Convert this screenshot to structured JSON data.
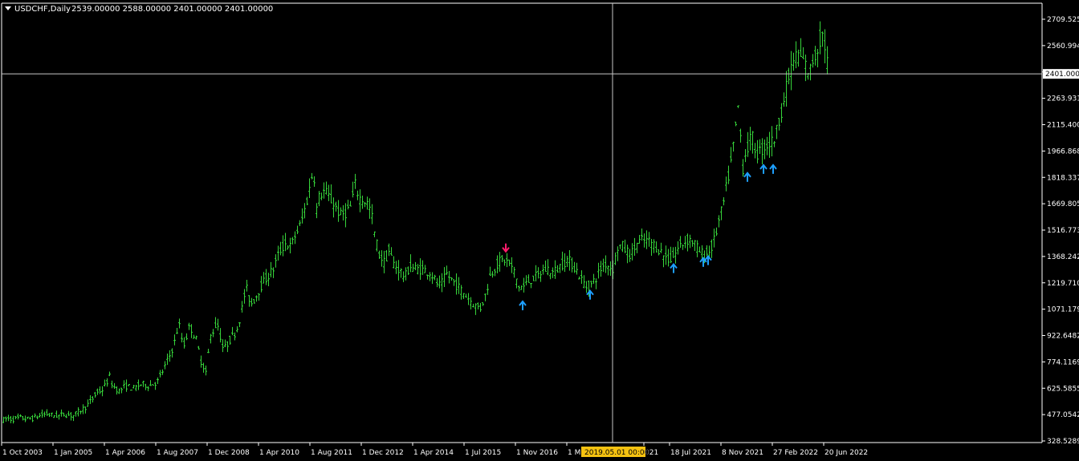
{
  "header": {
    "symbol": "USDCHF,Daily",
    "ohlc": "2539.00000 2588.00000 2401.00000 2401.00000"
  },
  "colors": {
    "background": "#000000",
    "bars": "#36d43a",
    "axis": "#ffffff",
    "crosshair": "#c8c8c8",
    "arrow_up": "#1e9fff",
    "arrow_down": "#ff1b6b",
    "cursor_label_bg": "#f5c211",
    "price_label_bg": "#ffffff"
  },
  "crosshair": {
    "price_label": "2401.00000",
    "time_label": "2019.05.01 00:00",
    "price": 2401.0
  },
  "chart_data": {
    "type": "ohlc",
    "ylim": [
      328.52894,
      2790
    ],
    "y_ticks": [
      "2709.52549",
      "2560.99409",
      "2401.00000",
      "2263.93125",
      "2115.40000",
      "1966.86875",
      "1818.33750",
      "1669.80550",
      "1516.77340",
      "1368.24225",
      "1219.71000",
      "1071.17900",
      "922.64825",
      "774.11690",
      "625.58555",
      "477.05420",
      "328.52894"
    ],
    "x_labels": [
      "1 Oct 2003",
      "1 Jan 2005",
      "1 Apr 2006",
      "1 Aug 2007",
      "1 Dec 2008",
      "1 Apr 2010",
      "1 Aug 2011",
      "1 Dec 2012",
      "1 Apr 2014",
      "1 Jul 2015",
      "1 Nov 2016",
      "1 M",
      "021",
      "18 Jul 2021",
      "8 Nov 2021",
      "27 Feb 2022",
      "20 Jun 2022"
    ],
    "path": [
      [
        0,
        440
      ],
      [
        8,
        455
      ],
      [
        16,
        450
      ],
      [
        24,
        460
      ],
      [
        32,
        452
      ],
      [
        40,
        455
      ],
      [
        48,
        470
      ],
      [
        56,
        480
      ],
      [
        64,
        475
      ],
      [
        72,
        470
      ],
      [
        80,
        480
      ],
      [
        90,
        470
      ],
      [
        98,
        495
      ],
      [
        106,
        520
      ],
      [
        114,
        560
      ],
      [
        120,
        600
      ],
      [
        128,
        620
      ],
      [
        136,
        690
      ],
      [
        140,
        640
      ],
      [
        148,
        610
      ],
      [
        156,
        640
      ],
      [
        166,
        625
      ],
      [
        176,
        650
      ],
      [
        186,
        640
      ],
      [
        196,
        665
      ],
      [
        204,
        740
      ],
      [
        212,
        820
      ],
      [
        218,
        900
      ],
      [
        222,
        1000
      ],
      [
        228,
        860
      ],
      [
        236,
        980
      ],
      [
        244,
        900
      ],
      [
        250,
        780
      ],
      [
        256,
        720
      ],
      [
        262,
        920
      ],
      [
        270,
        1000
      ],
      [
        278,
        840
      ],
      [
        286,
        900
      ],
      [
        294,
        950
      ],
      [
        300,
        1050
      ],
      [
        306,
        1200
      ],
      [
        312,
        1100
      ],
      [
        318,
        1140
      ],
      [
        324,
        1200
      ],
      [
        332,
        1250
      ],
      [
        340,
        1300
      ],
      [
        348,
        1400
      ],
      [
        356,
        1450
      ],
      [
        362,
        1420
      ],
      [
        368,
        1500
      ],
      [
        374,
        1550
      ],
      [
        380,
        1650
      ],
      [
        386,
        1770
      ],
      [
        390,
        1880
      ],
      [
        394,
        1640
      ],
      [
        398,
        1720
      ],
      [
        404,
        1740
      ],
      [
        410,
        1700
      ],
      [
        418,
        1650
      ],
      [
        424,
        1600
      ],
      [
        430,
        1620
      ],
      [
        436,
        1650
      ],
      [
        442,
        1770
      ],
      [
        448,
        1700
      ],
      [
        456,
        1680
      ],
      [
        462,
        1620
      ],
      [
        466,
        1500
      ],
      [
        472,
        1380
      ],
      [
        478,
        1340
      ],
      [
        484,
        1400
      ],
      [
        490,
        1330
      ],
      [
        498,
        1290
      ],
      [
        504,
        1250
      ],
      [
        510,
        1320
      ],
      [
        516,
        1300
      ],
      [
        522,
        1300
      ],
      [
        530,
        1290
      ],
      [
        536,
        1280
      ],
      [
        542,
        1230
      ],
      [
        548,
        1200
      ],
      [
        556,
        1270
      ],
      [
        562,
        1240
      ],
      [
        568,
        1210
      ],
      [
        574,
        1180
      ],
      [
        580,
        1150
      ],
      [
        586,
        1120
      ],
      [
        592,
        1090
      ],
      [
        598,
        1080
      ],
      [
        604,
        1150
      ],
      [
        610,
        1260
      ],
      [
        616,
        1310
      ],
      [
        622,
        1340
      ],
      [
        628,
        1350
      ],
      [
        634,
        1330
      ],
      [
        640,
        1280
      ],
      [
        646,
        1200
      ],
      [
        652,
        1200
      ],
      [
        658,
        1230
      ],
      [
        664,
        1250
      ],
      [
        670,
        1260
      ],
      [
        676,
        1290
      ],
      [
        682,
        1300
      ],
      [
        688,
        1280
      ],
      [
        694,
        1300
      ],
      [
        700,
        1330
      ],
      [
        706,
        1350
      ],
      [
        712,
        1330
      ],
      [
        718,
        1290
      ],
      [
        724,
        1240
      ],
      [
        730,
        1200
      ],
      [
        736,
        1210
      ],
      [
        742,
        1250
      ],
      [
        748,
        1300
      ],
      [
        754,
        1330
      ],
      [
        760,
        1310
      ],
      [
        764,
        1300
      ],
      [
        768,
        1420
      ],
      [
        774,
        1430
      ],
      [
        780,
        1400
      ],
      [
        786,
        1380
      ],
      [
        792,
        1440
      ],
      [
        798,
        1460
      ],
      [
        804,
        1460
      ],
      [
        810,
        1450
      ],
      [
        816,
        1430
      ],
      [
        822,
        1400
      ],
      [
        828,
        1370
      ],
      [
        834,
        1350
      ],
      [
        840,
        1380
      ],
      [
        846,
        1430
      ],
      [
        852,
        1450
      ],
      [
        858,
        1470
      ],
      [
        864,
        1450
      ],
      [
        870,
        1400
      ],
      [
        876,
        1380
      ],
      [
        882,
        1390
      ],
      [
        888,
        1440
      ],
      [
        894,
        1550
      ],
      [
        900,
        1650
      ],
      [
        906,
        1800
      ],
      [
        912,
        1950
      ],
      [
        916,
        2100
      ],
      [
        920,
        2250
      ],
      [
        924,
        1850
      ],
      [
        928,
        1950
      ],
      [
        932,
        2000
      ],
      [
        936,
        2050
      ],
      [
        942,
        1950
      ],
      [
        948,
        1970
      ],
      [
        954,
        2000
      ],
      [
        960,
        2010
      ],
      [
        966,
        2050
      ],
      [
        970,
        2150
      ],
      [
        976,
        2250
      ],
      [
        982,
        2380
      ],
      [
        988,
        2480
      ],
      [
        994,
        2510
      ],
      [
        1000,
        2470
      ],
      [
        1004,
        2440
      ],
      [
        1008,
        2400
      ],
      [
        1012,
        2480
      ],
      [
        1016,
        2510
      ],
      [
        1020,
        2590
      ],
      [
        1024,
        2620
      ],
      [
        1028,
        2540
      ],
      [
        1032,
        2401
      ]
    ],
    "signals": [
      {
        "type": "down",
        "i": 630,
        "price": 1380
      },
      {
        "type": "up",
        "i": 651,
        "price": 1130
      },
      {
        "type": "up",
        "i": 735,
        "price": 1190
      },
      {
        "type": "up",
        "i": 839,
        "price": 1340
      },
      {
        "type": "up",
        "i": 876,
        "price": 1375
      },
      {
        "type": "up",
        "i": 882,
        "price": 1385
      },
      {
        "type": "up",
        "i": 931,
        "price": 1855
      },
      {
        "type": "up",
        "i": 951,
        "price": 1900
      },
      {
        "type": "up",
        "i": 963,
        "price": 1900
      }
    ]
  }
}
